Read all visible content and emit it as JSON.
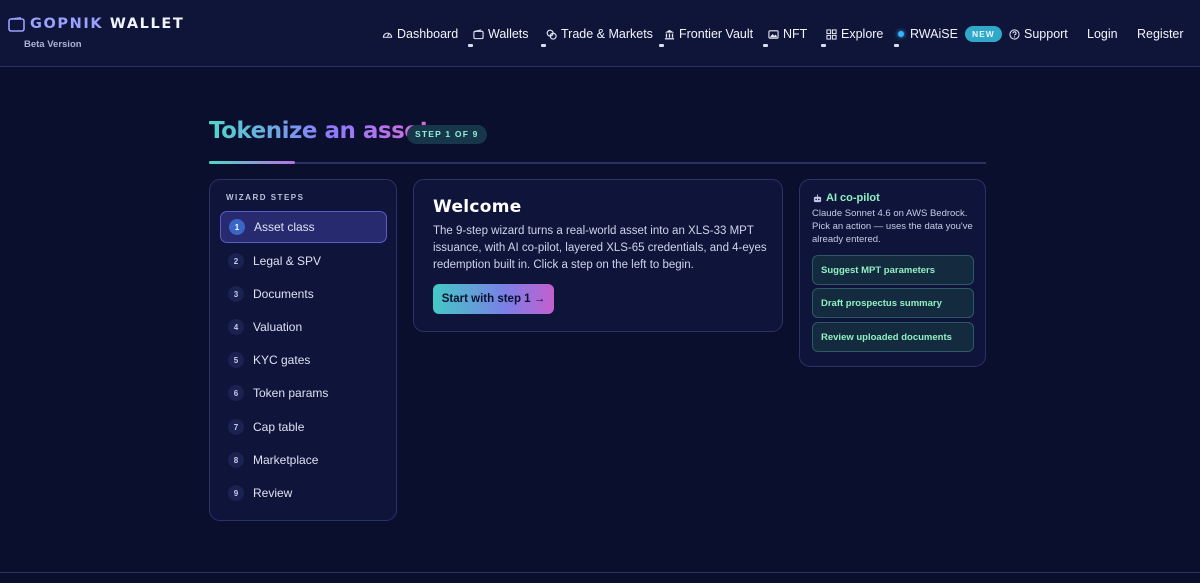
{
  "brand": {
    "name_part1": "GOPNIK",
    "name_part2": "WALLET",
    "subtitle": "Beta Version"
  },
  "nav": {
    "items": [
      {
        "label": "Dashboard",
        "icon": "gauge-icon"
      },
      {
        "label": "Wallets",
        "icon": "wallet-icon"
      },
      {
        "label": "Trade & Markets",
        "icon": "coins-icon"
      },
      {
        "label": "Frontier Vault",
        "icon": "bank-icon"
      },
      {
        "label": "NFT",
        "icon": "image-icon"
      },
      {
        "label": "Explore",
        "icon": "grid-icon"
      },
      {
        "label": "RWAiSE",
        "icon": "dot-icon",
        "badge": "NEW"
      },
      {
        "label": "Support",
        "icon": "help-icon"
      },
      {
        "label": "Login"
      },
      {
        "label": "Register"
      }
    ]
  },
  "page": {
    "title": "Tokenize an asset",
    "step_badge": "STEP 1 OF 9",
    "progress": 0.111
  },
  "wizard": {
    "heading": "WIZARD STEPS",
    "active_index": 0,
    "steps": [
      {
        "num": "1",
        "label": "Asset class"
      },
      {
        "num": "2",
        "label": "Legal & SPV"
      },
      {
        "num": "3",
        "label": "Documents"
      },
      {
        "num": "4",
        "label": "Valuation"
      },
      {
        "num": "5",
        "label": "KYC gates"
      },
      {
        "num": "6",
        "label": "Token params"
      },
      {
        "num": "7",
        "label": "Cap table"
      },
      {
        "num": "8",
        "label": "Marketplace"
      },
      {
        "num": "9",
        "label": "Review"
      }
    ]
  },
  "welcome": {
    "title": "Welcome",
    "body": "The 9-step wizard turns a real-world asset into an XLS-33 MPT issuance, with AI co-pilot, layered XLS-65 credentials, and 4-eyes redemption built in. Click a step on the left to begin.",
    "button": "Start with step 1 →"
  },
  "copilot": {
    "title": "AI co-pilot",
    "description": "Claude Sonnet 4.6 on AWS Bedrock. Pick an action — uses the data you've already entered.",
    "actions": [
      "Suggest MPT parameters",
      "Draft prospectus summary",
      "Review uploaded documents"
    ]
  },
  "colors": {
    "accent_teal": "#4fd8c8",
    "accent_purple": "#8c7bff",
    "accent_pink": "#d96ad8",
    "background": "#0b0f2e"
  }
}
